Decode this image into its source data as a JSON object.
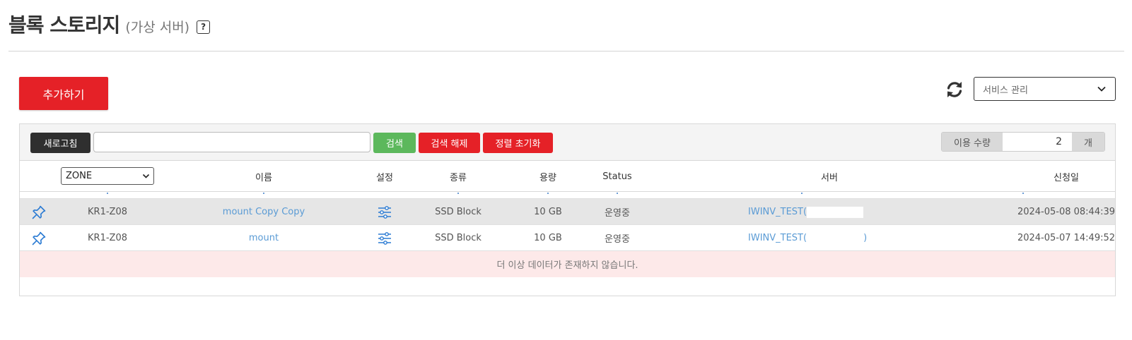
{
  "page": {
    "title": "블록 스토리지",
    "subtitle": "(가상 서버)",
    "help_label": "?"
  },
  "actions": {
    "add_label": "추가하기",
    "service_select": "서비스 관리"
  },
  "toolbar": {
    "refresh_label": "새로고침",
    "search_value": "",
    "search_label": "검색",
    "clear_label": "검색 해제",
    "sort_reset_label": "정렬 초기화",
    "usage_label": "이용 수량",
    "usage_value": "2",
    "usage_unit": "개"
  },
  "table": {
    "zone_filter": "ZONE",
    "headers": {
      "name": "이름",
      "settings": "설정",
      "type": "종류",
      "capacity": "용량",
      "status": "Status",
      "server": "서버",
      "requested": "신청일"
    },
    "rows": [
      {
        "zone": "KR1-Z08",
        "name": "mount Copy Copy",
        "type": "SSD Block",
        "capacity": "10 GB",
        "status": "운영중",
        "server": "IWINV_TEST(",
        "server_tail": "",
        "requested": "2024-05-08 08:44:39"
      },
      {
        "zone": "KR1-Z08",
        "name": "mount",
        "type": "SSD Block",
        "capacity": "10 GB",
        "status": "운영중",
        "server": "IWINV_TEST(",
        "server_tail": ")",
        "requested": "2024-05-07 14:49:52"
      }
    ],
    "no_more": "더 이상 데이터가 존재하지 않습니다."
  },
  "colors": {
    "primary_red": "#e52127",
    "search_green": "#5cb85c",
    "link_blue": "#5a9bd5",
    "dark_button": "#2f2f2f",
    "empty_row_bg": "#fde9e9"
  },
  "icons": [
    "help-icon",
    "refresh-icon",
    "chevron-down-icon",
    "pin-icon",
    "settings-sliders-icon"
  ]
}
